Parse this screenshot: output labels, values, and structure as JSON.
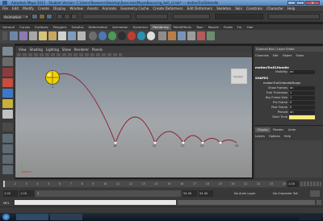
{
  "title_bar": {
    "title": "Autodesk Maya 2012 - Student Version: C:\\Users\\fleeeemr\\Desktop\\Exercises\\Maya\\Bouncing_ball_cl.mb* --- motionTrail1Handle",
    "min": "–",
    "max": "□",
    "close": "✕"
  },
  "menu": [
    "File",
    "Edit",
    "Modify",
    "Create",
    "Display",
    "Window",
    "Assets",
    "Animate",
    "Geometry Cache",
    "Create Deformers",
    "Edit Deformers",
    "Skeleton",
    "Skin",
    "Constrain",
    "Character",
    "Help"
  ],
  "status_line": {
    "mode": "Animation"
  },
  "shelf_tabs": [
    "General",
    "Curves",
    "Surfaces",
    "Polygons",
    "Subdivs",
    "Deformation",
    "Animation",
    "Dynamics",
    "Rendering",
    "PaintEffects",
    "Toon",
    "Muscle",
    "Fluids",
    "Fur",
    "Hair"
  ],
  "shelf_active": "Rendering",
  "viewport": {
    "menu": [
      "View",
      "Shading",
      "Lighting",
      "Show",
      "Renderer",
      "Panels"
    ],
    "frame_labels": [
      "1",
      "16",
      "22",
      "27",
      "33",
      "35"
    ],
    "view_cube": "FRONT",
    "axis_labels": {
      "y": "y",
      "x": "x"
    }
  },
  "channel_box": {
    "tabs": [
      "Channel Box / Layer Editor"
    ],
    "menu": [
      "Channels",
      "Edit",
      "Object",
      "Show"
    ],
    "object": "motionTrail1Handle",
    "attrs_top": [
      {
        "k": "Visibility",
        "v": "on"
      }
    ],
    "shapes_header": "SHAPES",
    "shape": "motionTrail1HandleShape",
    "attrs": [
      {
        "k": "Show Frames",
        "v": "on"
      },
      {
        "k": "Trail Thickness",
        "v": "1"
      },
      {
        "k": "Key Frame Size",
        "v": "1"
      },
      {
        "k": "Pre Frame",
        "v": "0"
      },
      {
        "k": "Post Frame",
        "v": "0"
      },
      {
        "k": "Pinned",
        "v": "on"
      },
      {
        "k": "Start Time",
        "v": ""
      }
    ],
    "layer_tabs": [
      "Display",
      "Render",
      "Anim"
    ],
    "layer_menu": [
      "Layers",
      "Options",
      "Help"
    ]
  },
  "time_slider": {
    "ticks": [
      "1",
      "2",
      "3",
      "4",
      "5",
      "6",
      "7",
      "8",
      "9",
      "10",
      "11",
      "12",
      "13",
      "14",
      "15",
      "16",
      "17",
      "18",
      "19",
      "20",
      "21",
      "22",
      "23",
      "24"
    ],
    "current": "1.00"
  },
  "range_slider": {
    "start": "1.00",
    "inner_start": "1.00",
    "range_label": "1",
    "end": "54.00",
    "outer_end": "54.00",
    "anim_layer": "No Anim Layer",
    "character": "No Character Set"
  },
  "command_line": {
    "label": "MEL"
  },
  "colors": {
    "trail": "#8b1f2c",
    "ball": "#f2d200",
    "accent": "#ffe77a"
  }
}
